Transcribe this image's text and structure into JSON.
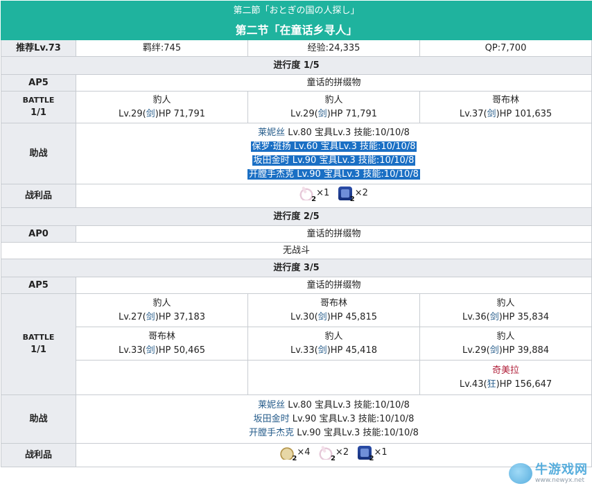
{
  "header": {
    "jp_title": "第二節「おとぎの国の人探し」",
    "cn_title": "第二节「在童话乡寻人」"
  },
  "summary": {
    "recommended": "推荐Lv.73",
    "bond": "羁绊:745",
    "exp": "经验:24,335",
    "qp": "QP:7,700"
  },
  "labels": {
    "battle": "BATTLE",
    "battle_count": "1/1",
    "support": "助战",
    "loot": "战利品"
  },
  "sections": [
    {
      "progress": "进行度 1/5",
      "ap": "AP5",
      "area": "童话的拼缀物",
      "enemies": [
        {
          "name": "豹人",
          "lv": "Lv.29(",
          "cls": "剑",
          "hp": ")HP 71,791"
        },
        {
          "name": "豹人",
          "lv": "Lv.29(",
          "cls": "剑",
          "hp": ")HP 71,791"
        },
        {
          "name": "哥布林",
          "lv": "Lv.37(",
          "cls": "剑",
          "hp": ")HP 101,635"
        }
      ],
      "support": [
        {
          "name": "莱妮丝",
          "rest": " Lv.80 宝具Lv.3 技能:10/10/8"
        },
        {
          "name": "保罗·班扬",
          "rest": " Lv.60 宝具Lv.3 技能:10/10/8"
        },
        {
          "name": "坂田金时",
          "rest": " Lv.90 宝具Lv.3 技能:10/10/8"
        },
        {
          "name": "开膛手杰克",
          "rest": " Lv.90 宝具Lv.3 技能:10/10/8"
        }
      ],
      "loot": [
        {
          "icon": "bunny-item-icon",
          "sub": "2",
          "count": "×1"
        },
        {
          "icon": "lantern-item-icon",
          "sub": "2",
          "count": "×2"
        }
      ]
    },
    {
      "progress": "进行度 2/5",
      "ap": "AP0",
      "area": "童话的拼缀物",
      "note": "无战斗"
    },
    {
      "progress": "进行度 3/5",
      "ap": "AP5",
      "area": "童话的拼缀物",
      "wave1": [
        {
          "name": "豹人",
          "lv": "Lv.27(",
          "cls": "剑",
          "hp": ")HP 37,183"
        },
        {
          "name": "哥布林",
          "lv": "Lv.30(",
          "cls": "剑",
          "hp": ")HP 45,815"
        },
        {
          "name": "豹人",
          "lv": "Lv.36(",
          "cls": "剑",
          "hp": ")HP 35,834"
        }
      ],
      "wave2": [
        {
          "name": "哥布林",
          "lv": "Lv.33(",
          "cls": "剑",
          "hp": ")HP 50,465"
        },
        {
          "name": "豹人",
          "lv": "Lv.33(",
          "cls": "剑",
          "hp": ")HP 45,418"
        },
        {
          "name": "豹人",
          "lv": "Lv.29(",
          "cls": "剑",
          "hp": ")HP 39,884"
        }
      ],
      "boss": {
        "name": "奇美拉",
        "lv": "Lv.43(",
        "cls": "狂",
        "hp": ")HP 156,647"
      },
      "support": [
        {
          "name": "莱妮丝",
          "rest": " Lv.80 宝具Lv.3 技能:10/10/8"
        },
        {
          "name": "坂田金时",
          "rest": " Lv.90 宝具Lv.3 技能:10/10/8"
        },
        {
          "name": "开膛手杰克",
          "rest": " Lv.90 宝具Lv.3 技能:10/10/8"
        }
      ],
      "loot": [
        {
          "icon": "pouch-item-icon",
          "sub": "2",
          "count": "×4"
        },
        {
          "icon": "bunny-item-icon",
          "sub": "2",
          "count": "×2"
        },
        {
          "icon": "lantern-item-icon",
          "sub": "2",
          "count": "×1"
        }
      ]
    }
  ],
  "watermark": {
    "title": "牛游戏网",
    "url": "www.newyx.net"
  },
  "colors": {
    "header_bg": "#1fb39e",
    "label_bg": "#eaecf0",
    "link_blue": "#245b8a",
    "boss_red": "#b0203a",
    "selection": "#1a6fc4"
  }
}
